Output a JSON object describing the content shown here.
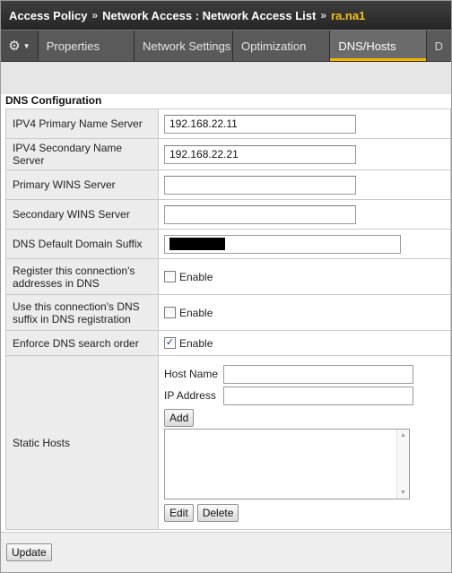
{
  "breadcrumb": {
    "items": [
      "Access Policy",
      "Network Access : Network Access List"
    ],
    "separator": "»",
    "current": "ra.na1"
  },
  "tabs": {
    "menu_icon": "gear-icon",
    "items": [
      "Properties",
      "Network Settings",
      "Optimization",
      "DNS/Hosts",
      "D"
    ],
    "active": "DNS/Hosts"
  },
  "section": {
    "title": "DNS Configuration"
  },
  "fields": {
    "ipv4_primary": {
      "label": "IPV4 Primary Name Server",
      "value": "192.168.22.11"
    },
    "ipv4_secondary": {
      "label": "IPV4 Secondary Name Server",
      "value": "192.168.22.21"
    },
    "primary_wins": {
      "label": "Primary WINS Server",
      "value": ""
    },
    "secondary_wins": {
      "label": "Secondary WINS Server",
      "value": ""
    },
    "dns_suffix": {
      "label": "DNS Default Domain Suffix",
      "value": ""
    },
    "register_connection": {
      "label_line1": "Register this connection's",
      "label_line2": "addresses in DNS",
      "checkbox_label": "Enable",
      "checked": false
    },
    "use_suffix": {
      "label_line1": "Use this connection's DNS",
      "label_line2": "suffix in DNS registration",
      "checkbox_label": "Enable",
      "checked": false
    },
    "enforce_order": {
      "label": "Enforce DNS search order",
      "checkbox_label": "Enable",
      "checked": true,
      "check_glyph": "✓"
    }
  },
  "static_hosts": {
    "label": "Static Hosts",
    "host_name_label": "Host Name",
    "ip_address_label": "IP Address",
    "add_label": "Add",
    "edit_label": "Edit",
    "delete_label": "Delete",
    "scroll_up_glyph": "▲",
    "scroll_down_glyph": "▼"
  },
  "footer": {
    "update_label": "Update"
  },
  "colors": {
    "accent": "#f5c21a",
    "active_tab_underline": "#f5b400",
    "header_bg": "#2e2e2e",
    "tab_bg": "#5a5a5a"
  }
}
